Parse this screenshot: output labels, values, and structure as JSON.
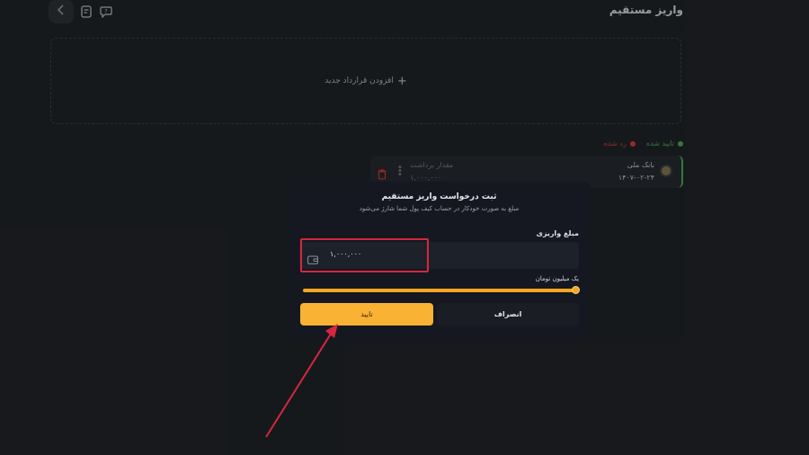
{
  "header": {
    "title": "واریز مستقیم",
    "icons": [
      "back-chevron-icon",
      "receipt-icon",
      "support-chat-icon"
    ]
  },
  "add_contract": {
    "label": "افزودن قرارداد جدید",
    "icon": "plus-icon"
  },
  "legend": [
    {
      "label": "تایید شده",
      "color": "#4caf50"
    },
    {
      "label": "رد شده",
      "color": "#e53935"
    }
  ],
  "contract_card": {
    "bank_name": "بانک ملی",
    "date": "۱۴۰۷-۰۲-۲۴",
    "withdraw_label": "مقدار برداشت",
    "withdraw_value": "۱,۰۰۰,۰۰۰",
    "status_color": "#4caf50"
  },
  "modal": {
    "title": "ثبت درخواست واریز مستقیم",
    "subtitle": "مبلغ به صورت خودکار در حساب کیف پول شما شارژ می‌شود",
    "field_label": "مبلغ واریزی",
    "amount_value": "۱,۰۰۰,۰۰۰",
    "amount_words": "یک میلیون تومان",
    "slider_fraction": 1.0,
    "cancel_label": "انصراف",
    "confirm_label": "تایید",
    "accent_color": "#f9b233",
    "highlight_color": "#d7263d"
  }
}
